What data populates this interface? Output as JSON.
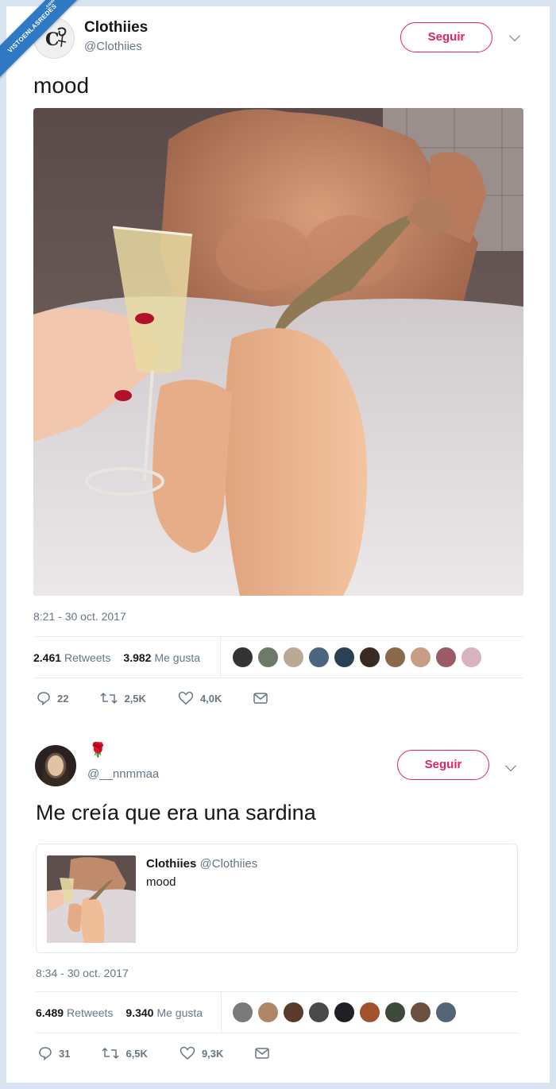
{
  "banner": {
    "text": "VISTOENLASREDES",
    "suffix": ".com"
  },
  "tweet1": {
    "name": "Clothiies",
    "handle": "@Clothiies",
    "follow_label": "Seguir",
    "text": "mood",
    "timestamp": "8:21 - 30 oct. 2017",
    "retweets": "2.461",
    "retweets_label": "Retweets",
    "likes": "3.982",
    "likes_label": "Me gusta",
    "replies": "22",
    "rt_count": "2,5K",
    "like_count": "4,0K"
  },
  "tweet2": {
    "name_emoji": "🌹",
    "handle": "@__nnmmaa",
    "follow_label": "Seguir",
    "text": "Me creía que era una sardina",
    "quote": {
      "name": "Clothiies",
      "handle": "@Clothiies",
      "text": "mood"
    },
    "timestamp": "8:34 - 30 oct. 2017",
    "retweets": "6.489",
    "retweets_label": "Retweets",
    "likes": "9.340",
    "likes_label": "Me gusta",
    "replies": "31",
    "rt_count": "6,5K",
    "like_count": "9,3K"
  },
  "colors": {
    "accent": "#e0245e",
    "muted": "#657786",
    "banner": "#2f79c4",
    "frame": "#d8e4f2"
  }
}
